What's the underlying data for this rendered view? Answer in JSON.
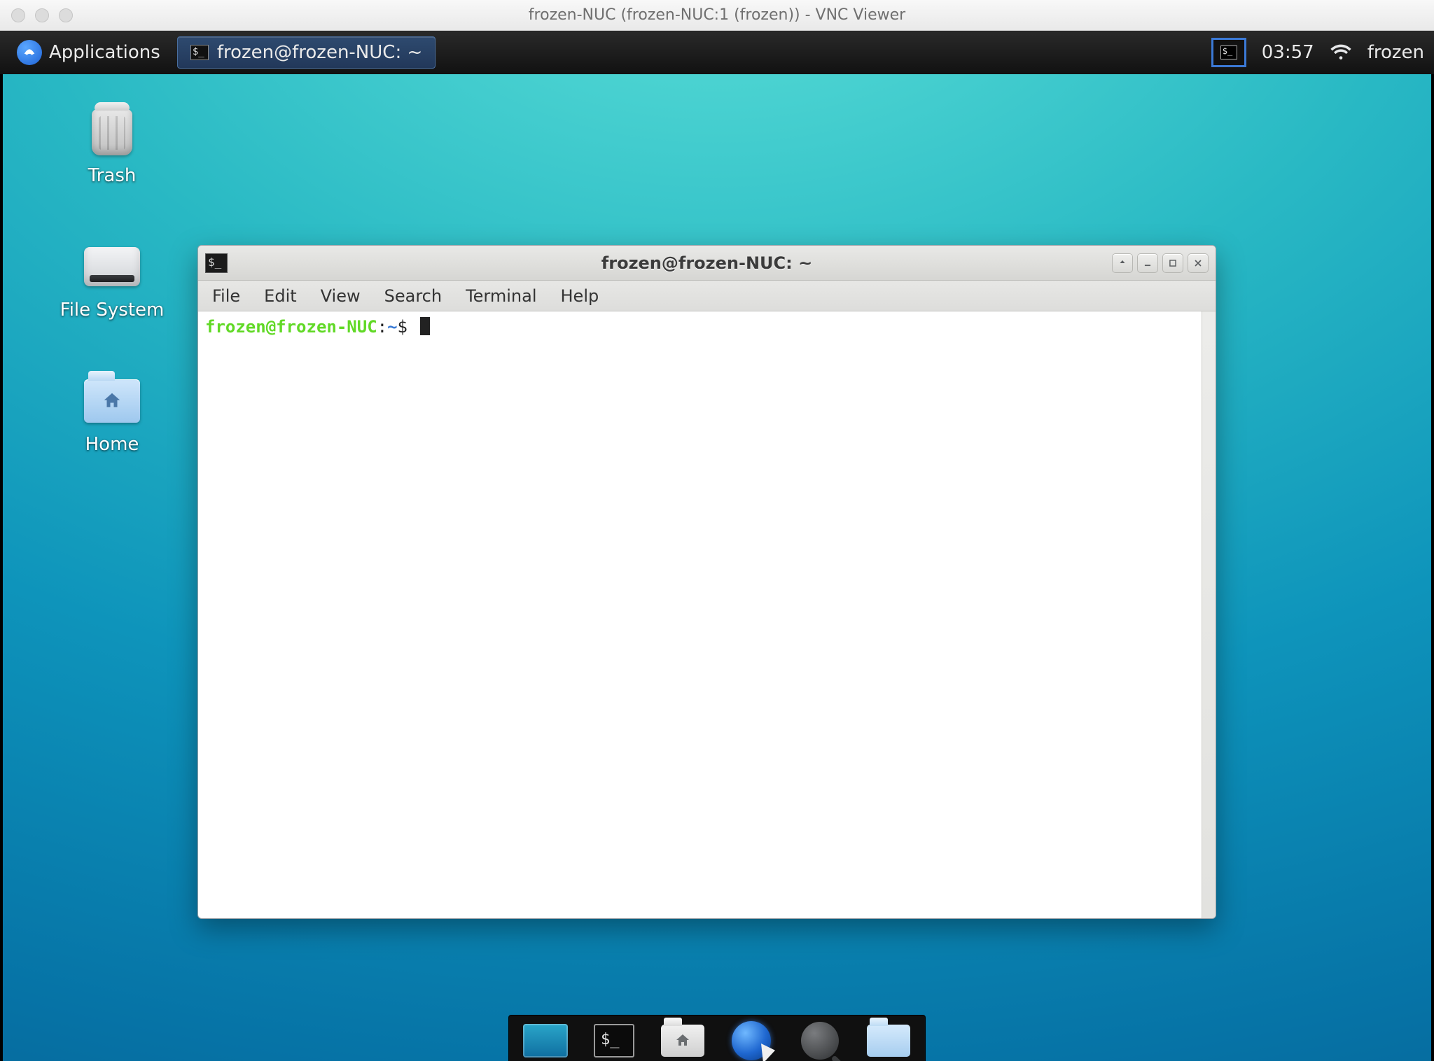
{
  "vnc": {
    "title": "frozen-NUC (frozen-NUC:1 (frozen)) - VNC Viewer"
  },
  "panel": {
    "applications_label": "Applications",
    "task_terminal_label": "frozen@frozen-NUC: ~",
    "clock": "03:57",
    "username": "frozen"
  },
  "desktop": {
    "trash_label": "Trash",
    "filesystem_label": "File System",
    "home_label": "Home"
  },
  "terminal": {
    "title": "frozen@frozen-NUC: ~",
    "menus": {
      "file": "File",
      "edit": "Edit",
      "view": "View",
      "search": "Search",
      "terminal": "Terminal",
      "help": "Help"
    },
    "prompt_user_host": "frozen@frozen-NUC",
    "prompt_sep": ":",
    "prompt_path": "~",
    "prompt_symbol": "$",
    "input_value": ""
  },
  "dock": {
    "items": [
      "show-desktop",
      "terminal",
      "file-manager",
      "web-browser",
      "app-finder",
      "folder"
    ]
  }
}
